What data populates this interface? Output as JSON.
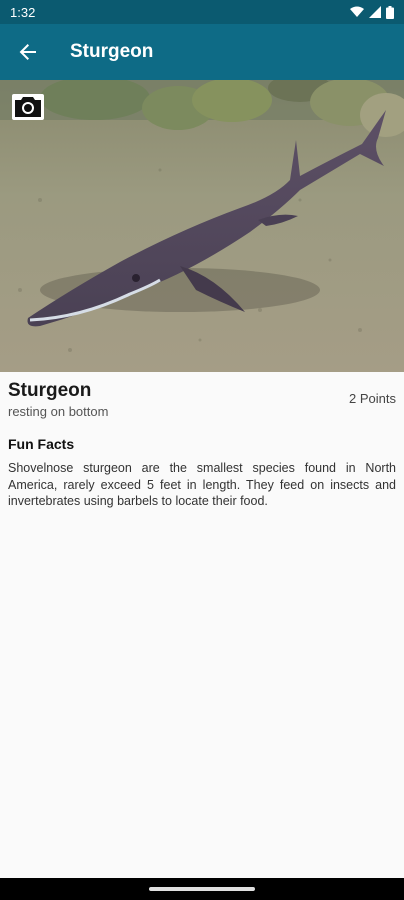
{
  "status": {
    "time": "1:32"
  },
  "header": {
    "title": "Sturgeon"
  },
  "species": {
    "name": "Sturgeon",
    "subtitle": "resting on bottom",
    "points": "2 Points"
  },
  "fun_facts": {
    "title": "Fun Facts",
    "body": "Shovelnose sturgeon are the smallest species found in North America, rarely exceed 5 feet in length. They feed on insects and invertebrates using barbels to locate their food."
  },
  "colors": {
    "status_bar": "#0b5a70",
    "app_bar": "#0e6b86",
    "background": "#fafafa"
  },
  "icons": {
    "back": "arrow-left-icon",
    "camera": "camera-icon",
    "wifi": "wifi-icon",
    "signal": "signal-icon",
    "battery": "battery-icon"
  }
}
